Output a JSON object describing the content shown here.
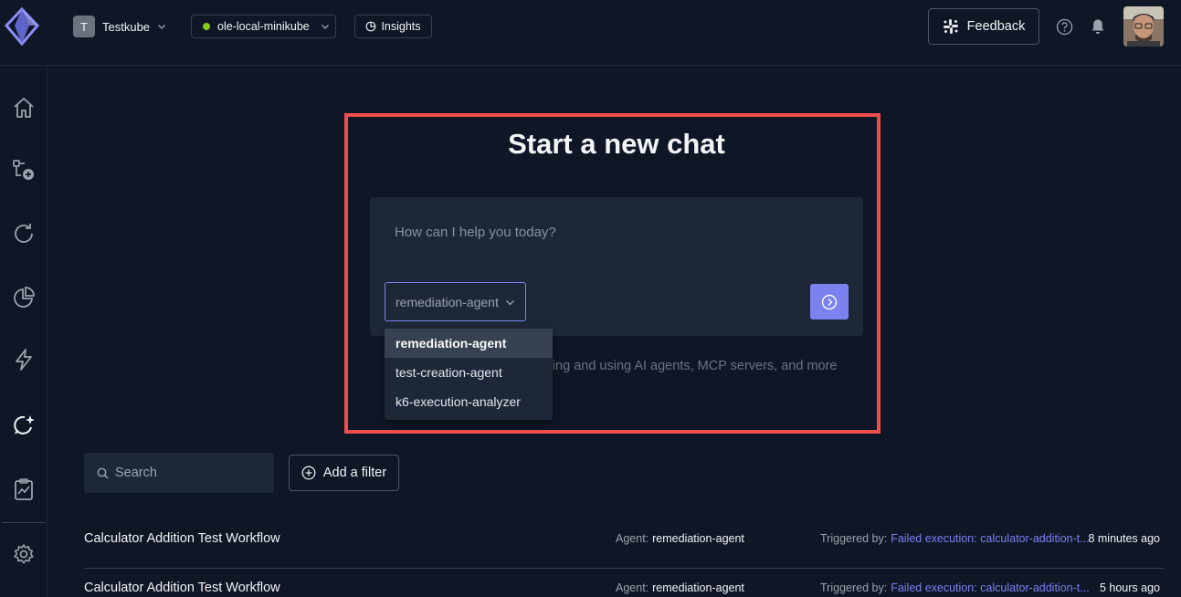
{
  "header": {
    "org": {
      "initial": "T",
      "name": "Testkube"
    },
    "environment": {
      "name": "ole-local-minikube",
      "status_color": "#84cc16"
    },
    "insights_label": "Insights",
    "feedback_label": "Feedback"
  },
  "sidebar": {
    "items": [
      {
        "name": "home",
        "icon": "home-icon"
      },
      {
        "name": "workflows",
        "icon": "workflow-add-icon"
      },
      {
        "name": "executions",
        "icon": "refresh-icon"
      },
      {
        "name": "analytics",
        "icon": "pie-chart-icon"
      },
      {
        "name": "triggers",
        "icon": "lightning-icon"
      },
      {
        "name": "ai-chat",
        "icon": "chat-sparkle-icon",
        "active": true
      },
      {
        "name": "reports",
        "icon": "clipboard-chart-icon"
      },
      {
        "name": "settings",
        "icon": "gear-icon"
      }
    ]
  },
  "chat": {
    "title": "Start a new chat",
    "input_placeholder": "How can I help you today?",
    "selected_agent": "remediation-agent",
    "agent_options": [
      "remediation-agent",
      "test-creation-agent",
      "k6-execution-analyzer"
    ],
    "hint_text": "ring and using AI agents, MCP servers, and more"
  },
  "filters": {
    "search_placeholder": "Search",
    "add_filter_label": "Add a filter"
  },
  "sessions": [
    {
      "title": "Calculator Addition Test Workflow",
      "agent_label": "Agent:",
      "agent": "remediation-agent",
      "trigger_label": "Triggered by:",
      "trigger": "Failed execution: calculator-addition-t...",
      "time": "8 minutes ago"
    },
    {
      "title": "Calculator Addition Test Workflow",
      "agent_label": "Agent:",
      "agent": "remediation-agent",
      "trigger_label": "Triggered by:",
      "trigger": "Failed execution: calculator-addition-t...",
      "time": "5 hours ago"
    }
  ],
  "colors": {
    "background": "#0f1626",
    "panel": "#1e2738",
    "accent": "#7b82f0",
    "highlight": "#ef4f4a"
  }
}
